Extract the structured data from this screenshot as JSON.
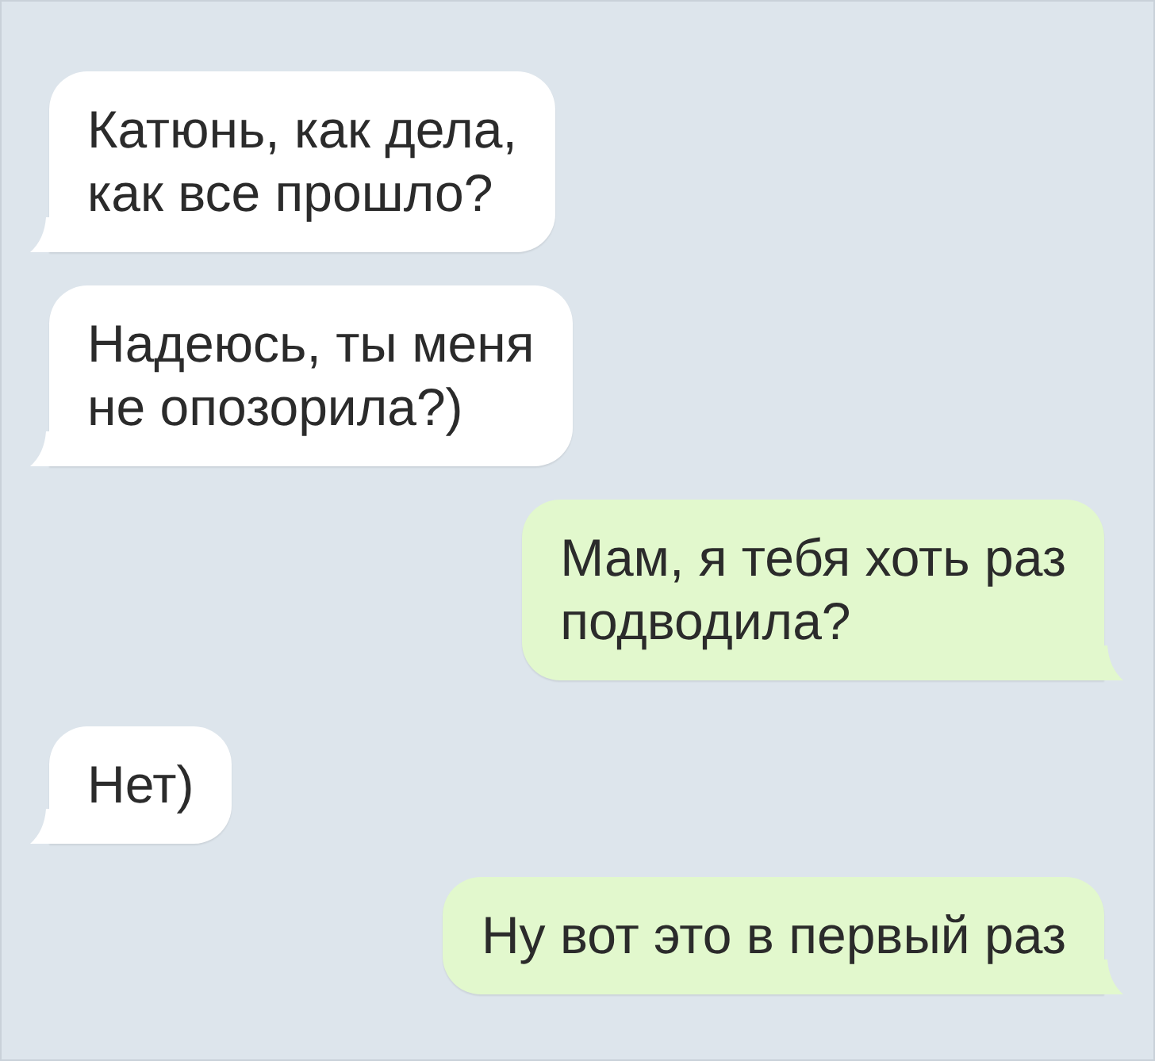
{
  "messages": [
    {
      "kind": "incoming",
      "text": "Катюнь, как дела,\nкак все прошло?"
    },
    {
      "kind": "incoming",
      "text": "Надеюсь, ты меня\nне опозорила?)"
    },
    {
      "kind": "outgoing",
      "text": "Мам, я тебя хоть раз\nподводила?"
    },
    {
      "kind": "incoming",
      "text": "Нет)"
    },
    {
      "kind": "outgoing",
      "text": "Ну вот это в первый раз"
    }
  ]
}
